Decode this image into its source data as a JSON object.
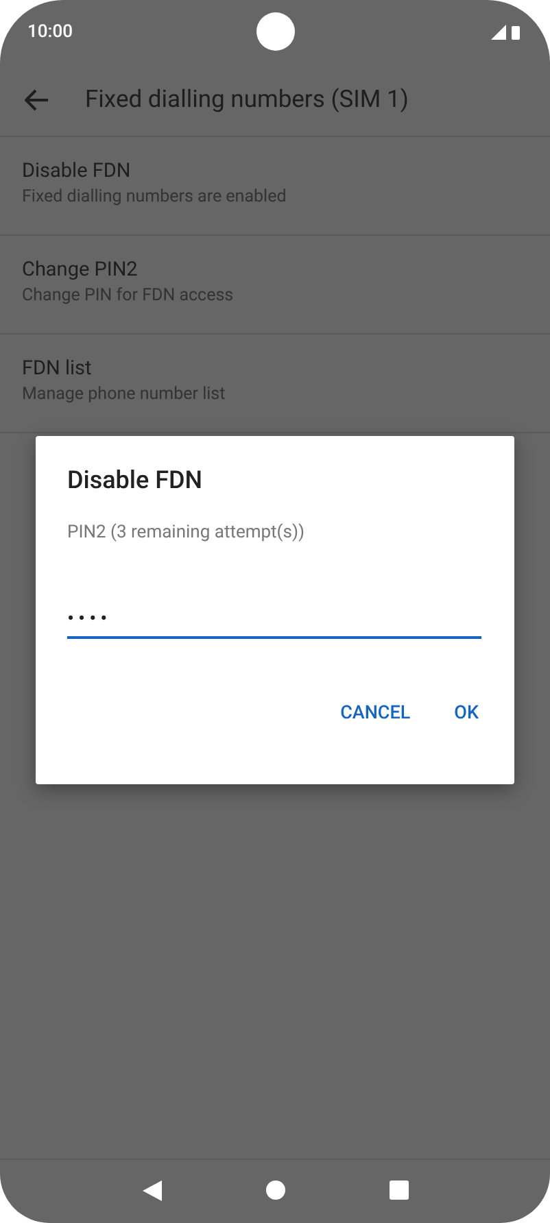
{
  "status_bar": {
    "time": "10:00"
  },
  "header": {
    "title": "Fixed dialling numbers (SIM 1)"
  },
  "items": [
    {
      "title": "Disable FDN",
      "subtitle": "Fixed dialling numbers are enabled"
    },
    {
      "title": "Change PIN2",
      "subtitle": "Change PIN for FDN access"
    },
    {
      "title": "FDN list",
      "subtitle": "Manage phone number list"
    }
  ],
  "dialog": {
    "title": "Disable FDN",
    "label": "PIN2 (3 remaining attempt(s))",
    "value": "••••",
    "buttons": [
      "CANCEL",
      "OK"
    ]
  }
}
